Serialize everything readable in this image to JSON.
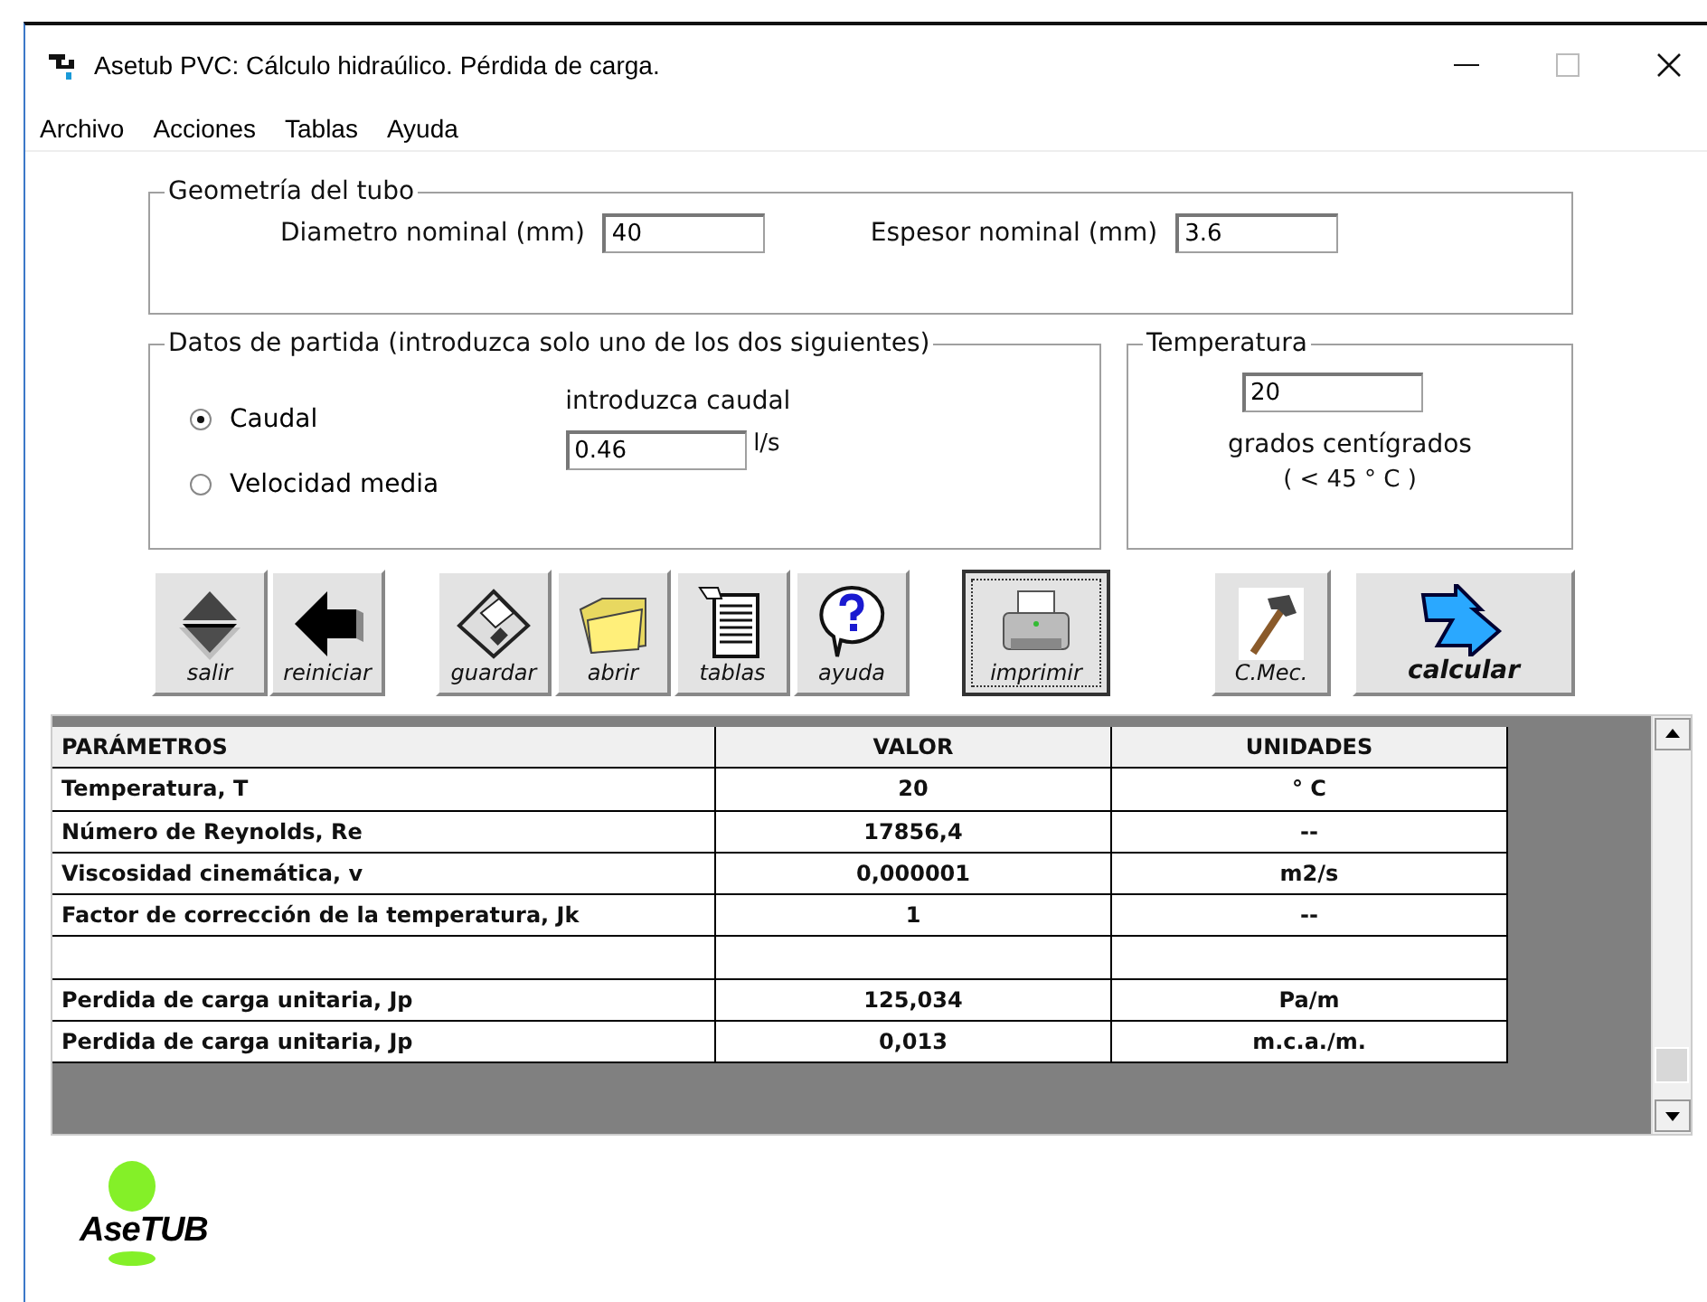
{
  "window": {
    "title": "Asetub PVC: Cálculo hidraúlico. Pérdida de carga."
  },
  "menu": [
    "Archivo",
    "Acciones",
    "Tablas",
    "Ayuda"
  ],
  "geometry": {
    "title": "Geometría del tubo",
    "fields": [
      {
        "label": "Diametro nominal (mm)",
        "value": "40"
      },
      {
        "label": "Espesor nominal (mm)",
        "value": "3.6"
      }
    ]
  },
  "input_data": {
    "title": "Datos de partida (introduzca solo uno de los dos siguientes)",
    "options": [
      {
        "label": "Caudal",
        "selected": true
      },
      {
        "label": "Velocidad media",
        "selected": false
      }
    ],
    "prompt": "introduzca caudal",
    "value": "0.46",
    "unit": "l/s"
  },
  "temperature": {
    "title": "Temperatura",
    "value": "20",
    "label": "grados centígrados",
    "range": "( < 45 ° C )"
  },
  "toolbar": [
    {
      "kind": "exit",
      "label": "salir",
      "focused": false
    },
    {
      "kind": "reset",
      "label": "reiniciar",
      "focused": false
    },
    {
      "kind": "save",
      "label": "guardar",
      "focused": false
    },
    {
      "kind": "open",
      "label": "abrir",
      "focused": false
    },
    {
      "kind": "tables",
      "label": "tablas",
      "focused": false
    },
    {
      "kind": "help",
      "label": "ayuda",
      "focused": false
    },
    {
      "kind": "print",
      "label": "imprimir",
      "focused": true
    },
    {
      "kind": "hammer",
      "label": "C.Mec.",
      "focused": false
    },
    {
      "kind": "run",
      "label": "calcular",
      "focused": false
    }
  ],
  "table": {
    "columns": [
      "PARÁMETROS",
      "VALOR",
      "UNIDADES"
    ],
    "rows": [
      {
        "kind": "data",
        "parameter": "Temperatura, T",
        "value": "20",
        "unit": "° C"
      },
      {
        "kind": "data",
        "parameter": "Número de Reynolds, Re",
        "value": "17856,4",
        "unit": "--"
      },
      {
        "kind": "data",
        "parameter": "Viscosidad cinemática, v",
        "value": "0,000001",
        "unit": "m2/s"
      },
      {
        "kind": "data",
        "parameter": "Factor de corrección de la temperatura, Jk",
        "value": "1",
        "unit": "--"
      },
      {
        "kind": "blank"
      },
      {
        "kind": "data",
        "parameter": "Perdida de carga unitaria, Jp",
        "value": "125,034",
        "unit": "Pa/m"
      },
      {
        "kind": "data",
        "parameter": "Perdida de carga unitaria, Jp",
        "value": "0,013",
        "unit": "m.c.a./m."
      }
    ]
  },
  "logo": {
    "text": "AseTUB"
  }
}
